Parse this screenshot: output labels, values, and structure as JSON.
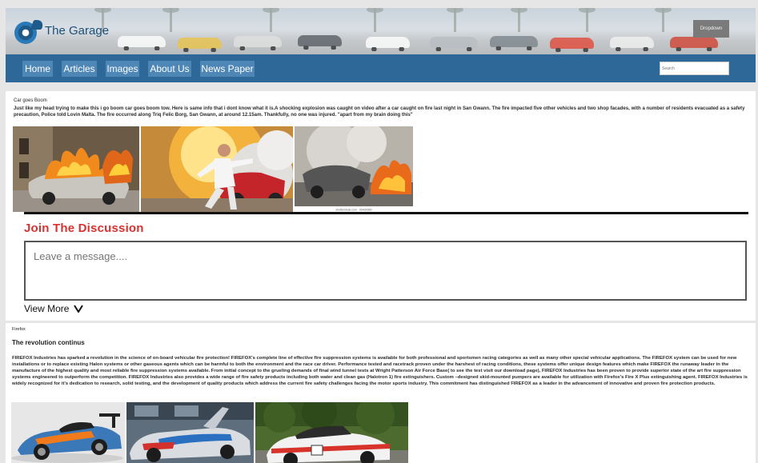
{
  "header": {
    "site_title": "The Garage",
    "dropdown_label": "Dropdown"
  },
  "nav": {
    "items": [
      {
        "label": "Home"
      },
      {
        "label": "Articles"
      },
      {
        "label": "Images"
      },
      {
        "label": "About Us"
      },
      {
        "label": "News Paper"
      }
    ],
    "search_placeholder": "Search"
  },
  "article1": {
    "title": "Car goes Boom",
    "body": "Just like my head trying to make this i go boom car goes boom tow. Here is same info that i dont know what it is.A shocking explosion was caught on video after a car caught on fire last night in San Gwann. The fire impacted five other vehicles and two shop facades, with a number of residents evacuated as a safety precaution, Police told Lovin Malta. The fire occurred along Triq Felic Borg, San Gwann, at around 12.15am. Thankfully, no one was injured. \"apart from my brain doing this\"",
    "image_watermark": "shutterstock.com · 93439360"
  },
  "discussion": {
    "heading": "Join The Discussion",
    "placeholder": "Leave a message....",
    "view_more": "View More",
    "view_more_icon": "chevron-down-icon"
  },
  "article2": {
    "title": "Firefox",
    "subtitle": "The revolution continus",
    "body": "FIREFOX Industries has sparked a revolution in the science of on-board vehicular fire protection! FIREFOX's complete line of effective fire suppression systems is available for both professional and sportsmen racing categories as well as many other special vehicular applications. The FIREFOX system can be used for new installations or to replace existing Halon systems or other gaseous agents which can be harmful to both the environment and the race car driver. Performance tested and racetrack proven under the harshest of racing conditions, these systems offer unique design features which make FIREFOX the runaway leader in the manufacture of the highest quality and most reliable fire suppression systems available. From initial concept to the grueling demands of final wind tunnel tests at Wright Patterson Air Force Base( to see the test visit our download page), FIREFOX Industries has been proven to provide superior state of the art fire suppression systems engineered to outperform the competition. FIREFOX Industries also provides a wide range of fire safety products including both water and clean gas (Halotron 1) fire extinguishers. Custom –designed skid-mounted pumpers are available for utilization with Firefox's Fire X Plus extinguishing agent. FIREFOX Industries is widely recognized for it's dedication to research, solid testing, and the development of quality products which address the current fire safety challenges facing the motor sports industry. This commitment has distinguished FIREFOX as a leader in the advancement of innovative and proven fire protection products."
  },
  "colors": {
    "nav_bg": "#2d6898",
    "nav_button": "#4e86b5",
    "heading_red": "#d93030",
    "dropdown_bg": "#7a7a7a"
  }
}
